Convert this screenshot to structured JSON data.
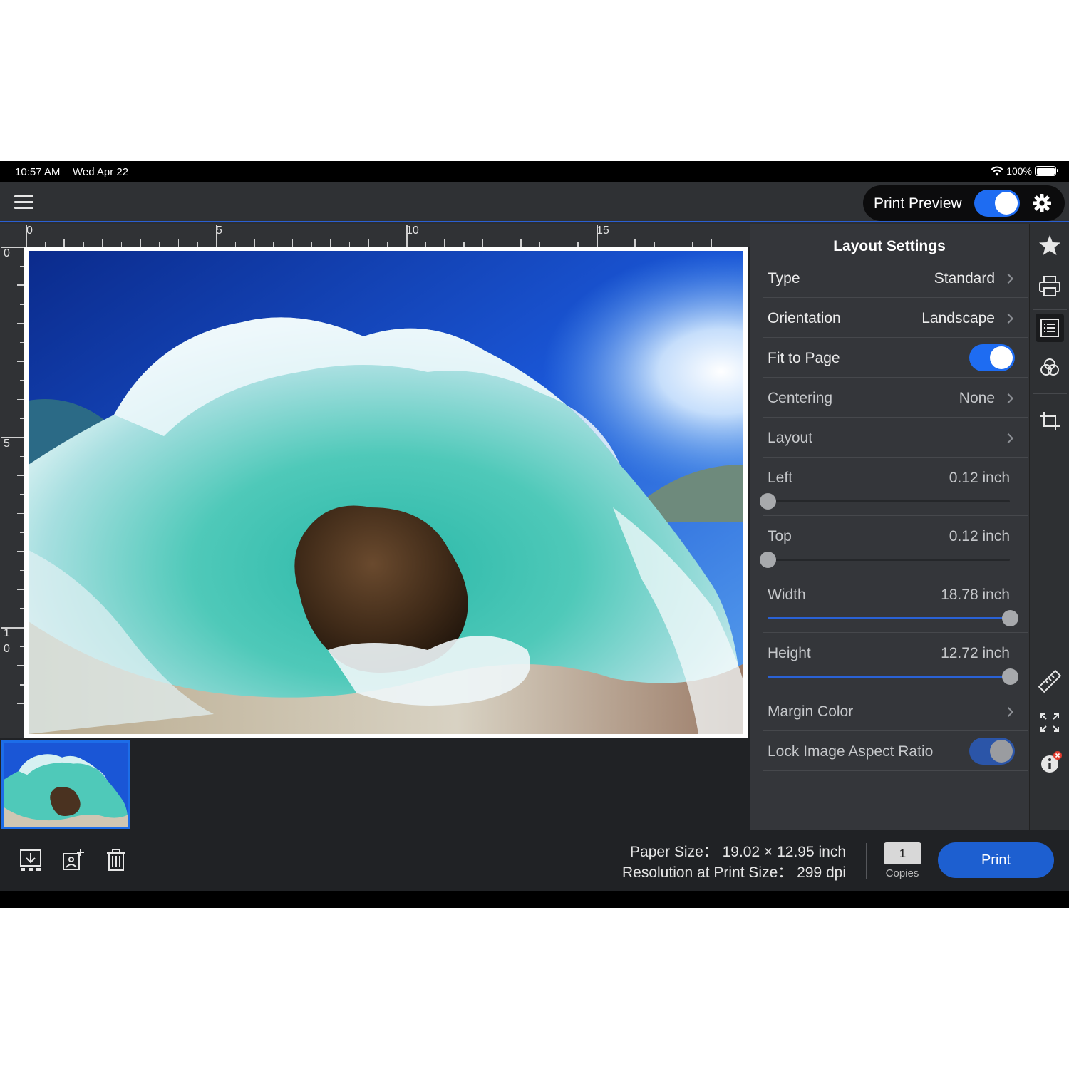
{
  "status_bar": {
    "time": "10:57 AM",
    "date": "Wed Apr 22",
    "battery": "100%"
  },
  "toolbar": {
    "print_preview_label": "Print Preview",
    "print_preview_on": true
  },
  "ruler": {
    "top_labels": [
      "0",
      "5",
      "10",
      "15"
    ],
    "left_labels": [
      "0",
      "5",
      "1",
      "0"
    ]
  },
  "panel": {
    "title": "Layout Settings",
    "type": {
      "label": "Type",
      "value": "Standard"
    },
    "orientation": {
      "label": "Orientation",
      "value": "Landscape"
    },
    "fit_to_page": {
      "label": "Fit to Page",
      "on": true
    },
    "centering": {
      "label": "Centering",
      "value": "None"
    },
    "layout": {
      "label": "Layout"
    },
    "left": {
      "label": "Left",
      "value": "0.12 inch",
      "level": 0
    },
    "top": {
      "label": "Top",
      "value": "0.12 inch",
      "level": 0
    },
    "width": {
      "label": "Width",
      "value": "18.78 inch",
      "level": 1.0
    },
    "height": {
      "label": "Height",
      "value": "12.72 inch",
      "level": 1.0
    },
    "margin_color": {
      "label": "Margin Color"
    },
    "lock_aspect": {
      "label": "Lock Image Aspect Ratio",
      "on": true
    }
  },
  "rail_icons": [
    "star-icon",
    "printer-icon",
    "layout-settings-icon",
    "color-icon",
    "crop-icon",
    "ruler-icon",
    "expand-icon",
    "info-icon"
  ],
  "bottom": {
    "paper_size_line": "Paper Size： 19.02 × 12.95 inch",
    "resolution_line": "Resolution at Print Size： 299 dpi",
    "copies_value": "1",
    "copies_label": "Copies",
    "print_label": "Print"
  },
  "colors": {
    "accent": "#1e6cf2",
    "panel": "#34363a",
    "toolbar": "#2f3134",
    "print_button": "#1d5fd0"
  }
}
